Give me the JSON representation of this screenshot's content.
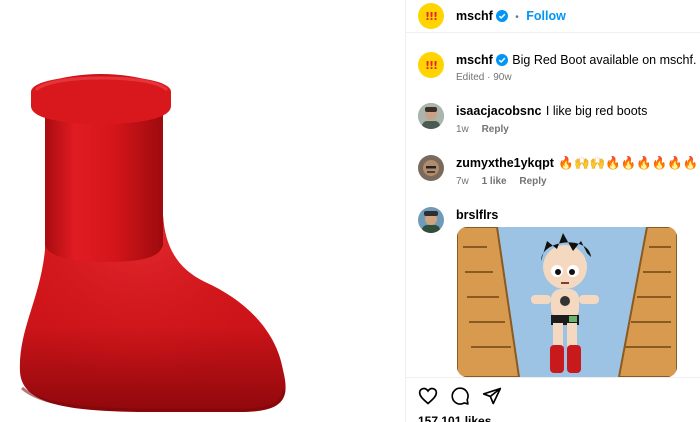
{
  "post": {
    "author": "mschf",
    "avatar_text": "!!!",
    "follow_label": "Follow",
    "separator": "•",
    "caption": "Big Red Boot available on mschf.com",
    "caption_meta": "Edited · 90w"
  },
  "comments": [
    {
      "user": "isaacjacobsnc",
      "text": "I like big red boots",
      "age": "1w",
      "likes": "",
      "reply": "Reply"
    },
    {
      "user": "zumyxthe1ykqpt",
      "text": "🔥🙌🙌🔥🔥🔥🔥🔥🔥",
      "age": "7w",
      "likes": "1 like",
      "reply": "Reply"
    },
    {
      "user": "brslflrs",
      "text": "",
      "age": "",
      "likes": "",
      "reply": ""
    }
  ],
  "footer": {
    "likes_text": "157,101 likes"
  },
  "icons": [
    "heart-icon",
    "comment-icon",
    "share-icon",
    "verified-badge-icon"
  ],
  "colors": {
    "accent": "#0095f6",
    "boot_red": "#d8161b",
    "mschf_yellow": "#ffd400"
  }
}
